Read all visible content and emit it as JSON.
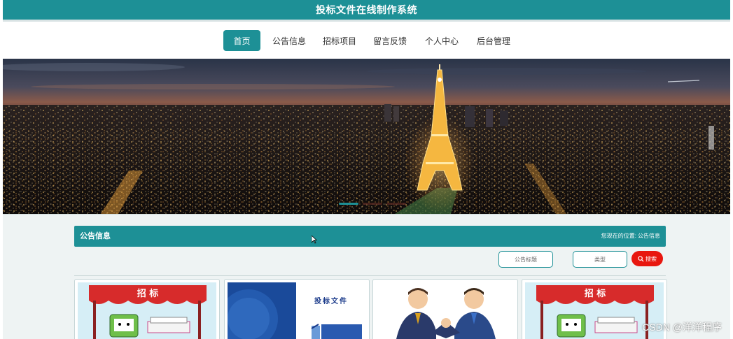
{
  "header": {
    "title": "投标文件在线制作系统"
  },
  "nav": {
    "items": [
      {
        "label": "首页",
        "active": true
      },
      {
        "label": "公告信息",
        "active": false
      },
      {
        "label": "招标项目",
        "active": false
      },
      {
        "label": "留言反馈",
        "active": false
      },
      {
        "label": "个人中心",
        "active": false
      },
      {
        "label": "后台管理",
        "active": false
      }
    ]
  },
  "section": {
    "title": "公告信息",
    "breadcrumb_prefix": "您现在的位置:",
    "breadcrumb_current": "公告信息"
  },
  "search": {
    "title_placeholder": "公告标题",
    "type_placeholder": "类型",
    "button_label": "搜索"
  },
  "cards": [
    {
      "banner_text": "招  标"
    },
    {
      "book_text": "投标文件"
    },
    {
      "kind": "handshake"
    },
    {
      "banner_text": "招  标"
    }
  ],
  "watermark": "CSDN @洋洋程序",
  "colors": {
    "primary": "#1d9096",
    "search_button": "#e8170f",
    "carousel_indicator": "#1d9096"
  }
}
